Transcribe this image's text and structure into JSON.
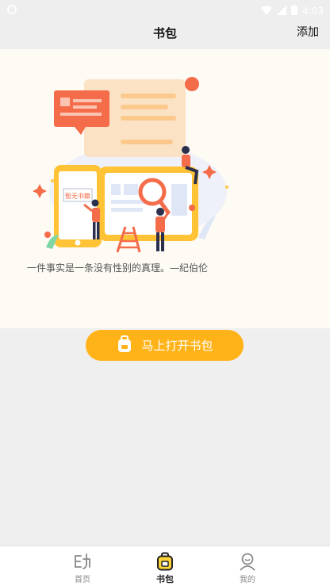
{
  "status_bar": {
    "time": "4:03"
  },
  "nav": {
    "title": "书包",
    "action_label": "添加"
  },
  "illustration": {
    "sign_text": "暂无书籍"
  },
  "quote": "一件事实是一条没有性别的真理。—纪伯伦",
  "open_button": {
    "label": "马上打开书包"
  },
  "tabs": [
    {
      "label": "首页",
      "icon": "home-icon",
      "active": false
    },
    {
      "label": "书包",
      "icon": "schoolbag-icon",
      "active": true
    },
    {
      "label": "我的",
      "icon": "profile-icon",
      "active": false
    }
  ],
  "colors": {
    "accent": "#ffb319",
    "coral": "#f46c4a",
    "background": "#efefef",
    "hero_background": "#fefbf5"
  }
}
